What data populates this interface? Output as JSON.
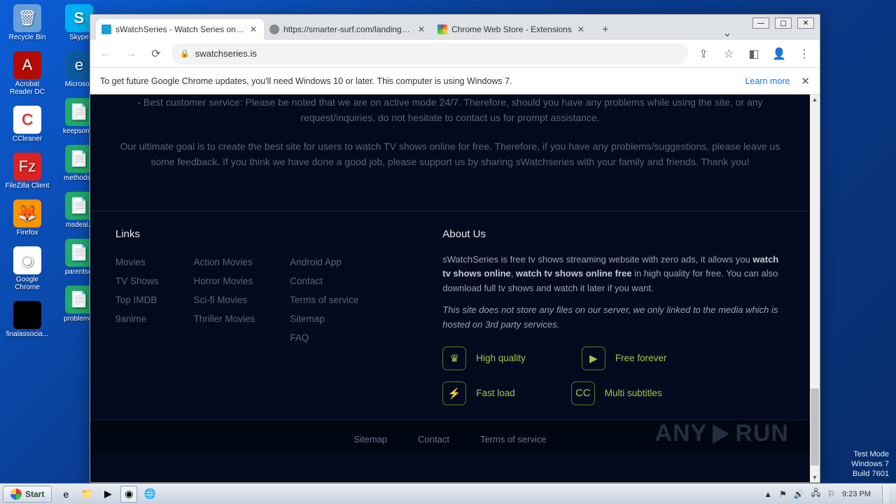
{
  "desktop": {
    "icons_col1": [
      {
        "label": "Recycle Bin"
      },
      {
        "label": "Acrobat Reader DC"
      },
      {
        "label": "CCleaner"
      },
      {
        "label": "FileZilla Client"
      },
      {
        "label": "Firefox"
      },
      {
        "label": "Google Chrome"
      },
      {
        "label": "finalassocia..."
      }
    ],
    "icons_col2": [
      {
        "label": "Skype"
      },
      {
        "label": "Microsoft"
      },
      {
        "label": "keepsome"
      },
      {
        "label": "methodsp"
      },
      {
        "label": "msdeal.r"
      },
      {
        "label": "parentscl"
      },
      {
        "label": "problemdi"
      }
    ],
    "watermark": {
      "l1": "Test Mode",
      "l2": "Windows 7",
      "l3": "Build 7601"
    }
  },
  "chrome": {
    "tabs": [
      {
        "title": "sWatchSeries - Watch Series online"
      },
      {
        "title": "https://smarter-surf.com/landing/?e"
      },
      {
        "title": "Chrome Web Store - Extensions"
      }
    ],
    "url": "swatchseries.is",
    "infobar": {
      "msg": "To get future Google Chrome updates, you'll need Windows 10 or later. This computer is using Windows 7.",
      "link": "Learn more"
    }
  },
  "page": {
    "top_p1": "- Best customer service: Please be noted that we are on active mode 24/7. Therefore, should you have any problems while using the site, or any request/inquiries, do not hesitate to contact us for prompt assistance.",
    "top_p2": "Our ultimate goal is to create the best site for users to watch TV shows online for free. Therefore, if you have any problems/suggestions, please leave us some feedback. If you think we have done a good job, please support us by sharing sWatchseries with your family and friends. Thank you!",
    "links_h": "Links",
    "about_h": "About Us",
    "link_col1": [
      "Movies",
      "TV Shows",
      "Top IMDB",
      "9anime"
    ],
    "link_col2": [
      "Action Movies",
      "Horror Movies",
      "Sci-fi Movies",
      "Thriller Movies"
    ],
    "link_col3": [
      "Android App",
      "Contact",
      "Terms of service",
      "Sitemap",
      "FAQ"
    ],
    "about_text_pre": "sWatchSeries is free tv shows streaming website with zero ads, it allows you ",
    "about_bold1": "watch tv shows online",
    "about_mid": ", ",
    "about_bold2": "watch tv shows online free",
    "about_text_post": " in high quality for free. You can also download full tv shows and watch it later if you want.",
    "disclaimer": "This site does not store any files on our server, we only linked to the media which is hosted on 3rd party services.",
    "badges": {
      "b1": "High quality",
      "b2": "Free forever",
      "b3": "Fast load",
      "b4": "Multi subtitles"
    },
    "fb": {
      "sitemap": "Sitemap",
      "contact": "Contact",
      "tos": "Terms of service"
    },
    "anyrun_pre": "ANY",
    "anyrun_post": "RUN"
  },
  "taskbar": {
    "start": "Start",
    "time": "9:23 PM"
  }
}
